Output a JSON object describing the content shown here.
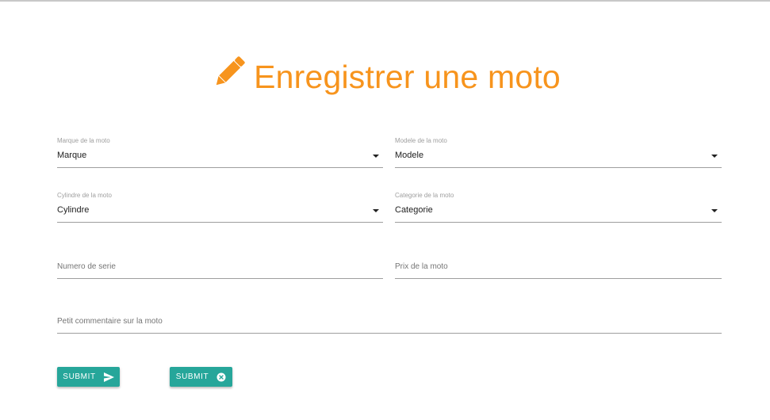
{
  "header": {
    "title": "Enregistrer une moto",
    "icon": "pencil-icon",
    "accent_color": "#f7941d"
  },
  "form": {
    "marque": {
      "label": "Marque de la moto",
      "value": "Marque"
    },
    "modele": {
      "label": "Modele de la moto",
      "value": "Modele"
    },
    "cylindre": {
      "label": "Cylindre de la moto",
      "value": "Cylindre"
    },
    "categorie": {
      "label": "Categorie de la moto",
      "value": "Categorie"
    },
    "numero_serie": {
      "placeholder": "Numero de serie"
    },
    "prix": {
      "placeholder": "Prix de la moto"
    },
    "commentaire": {
      "placeholder": "Petit commentaire sur la moto"
    }
  },
  "buttons": {
    "submit": {
      "label": "Submit",
      "icon": "send-icon"
    },
    "cancel": {
      "label": "Submit",
      "icon": "cancel-circle-icon"
    },
    "color": "#26a69a"
  }
}
